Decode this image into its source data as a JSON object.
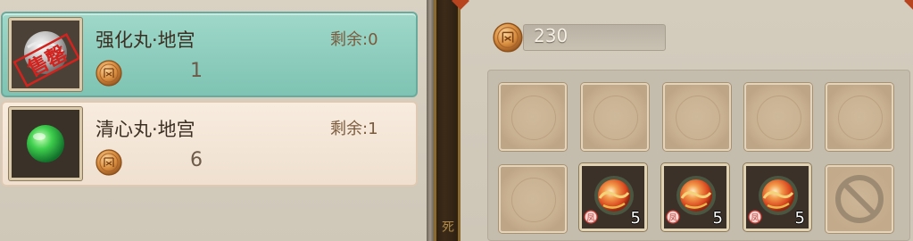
{
  "shop": {
    "items": [
      {
        "name": "强化丸·地宫",
        "remain": "剩余:0",
        "price": "1",
        "stamp": "售罄",
        "selected": true
      },
      {
        "name": "清心丸·地宫",
        "remain": "剩余:1",
        "price": "6",
        "selected": false
      }
    ]
  },
  "middle": {
    "glyph": "死"
  },
  "bag": {
    "currency": {
      "icon": "feng-coin-icon",
      "value": "230"
    },
    "slots": [
      {
        "state": "empty"
      },
      {
        "state": "empty"
      },
      {
        "state": "empty"
      },
      {
        "state": "empty"
      },
      {
        "state": "empty"
      },
      {
        "state": "empty"
      },
      {
        "state": "item",
        "icon": "red-orb-pill-icon",
        "count": "5"
      },
      {
        "state": "item",
        "icon": "red-orb-pill-icon",
        "count": "5"
      },
      {
        "state": "item",
        "icon": "red-orb-pill-icon",
        "count": "5"
      },
      {
        "state": "locked",
        "icon": "prohibited-icon"
      }
    ]
  },
  "colors": {
    "selected_bg": "#8fcfbf",
    "normal_bg": "#f4e7d8",
    "coin": "#c8843a"
  }
}
